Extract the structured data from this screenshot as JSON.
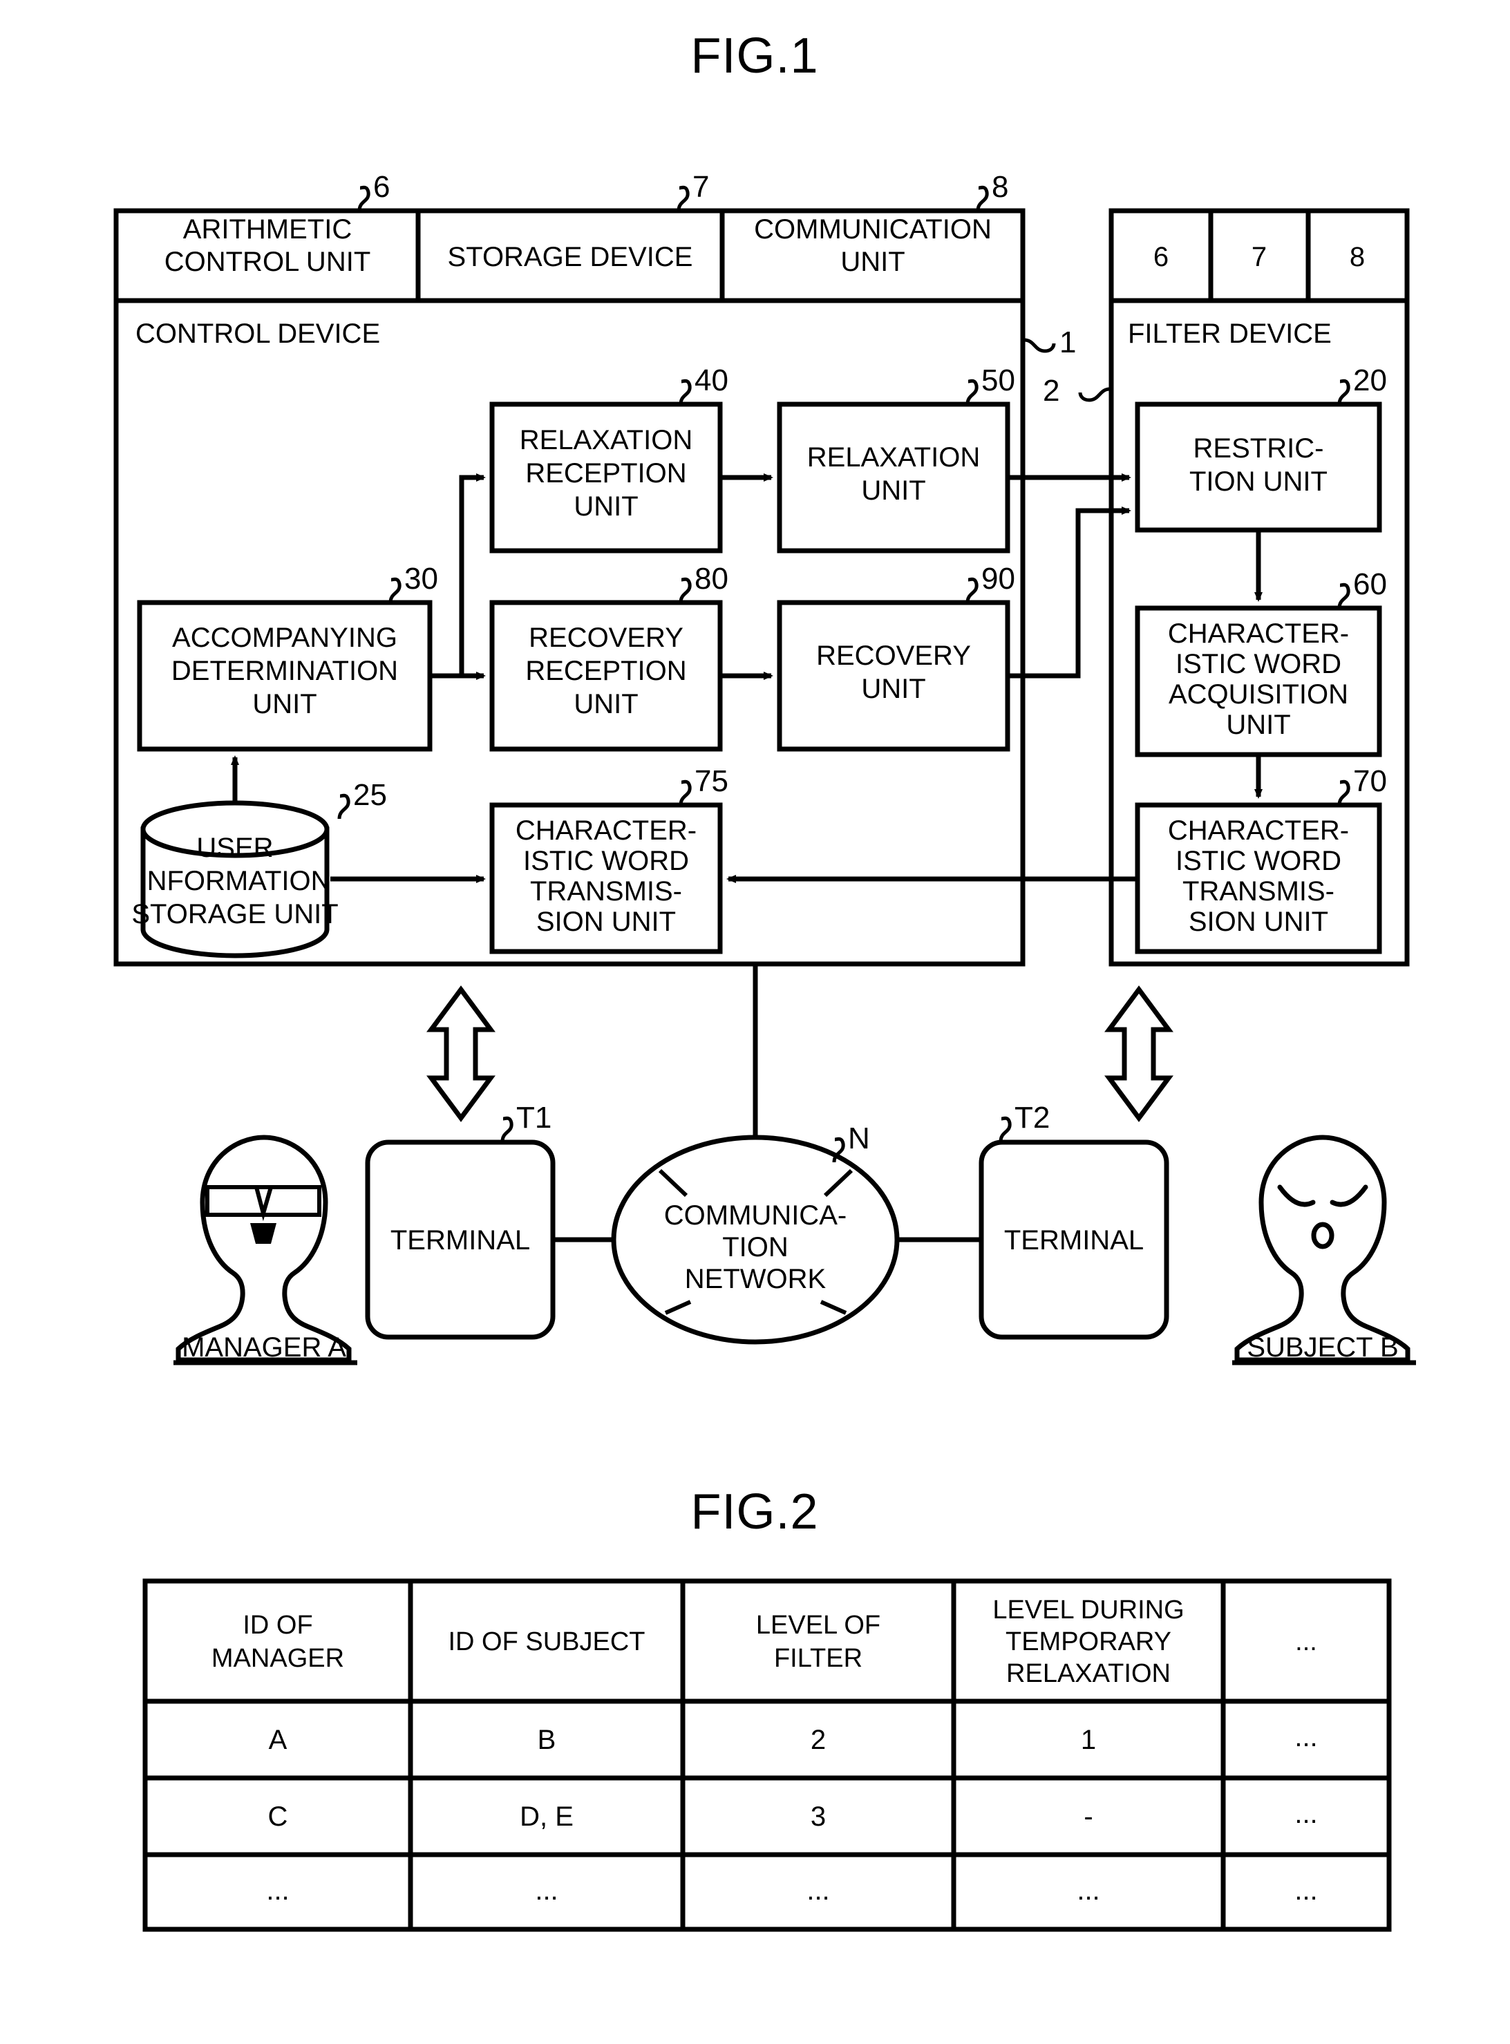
{
  "figures": [
    {
      "id": "fig1",
      "title": "FIG.1"
    },
    {
      "id": "fig2",
      "title": "FIG.2"
    }
  ],
  "fig1": {
    "title": "FIG.1",
    "control_device": {
      "name": "CONTROL DEVICE",
      "ref": "1",
      "hardware_row": [
        {
          "label": "ARITHMETIC CONTROL UNIT",
          "line1": "ARITHMETIC",
          "line2": "CONTROL UNIT",
          "ref": "6"
        },
        {
          "label": "STORAGE DEVICE",
          "line1": "STORAGE DEVICE",
          "line2": "",
          "ref": "7"
        },
        {
          "label": "COMMUNICATION UNIT",
          "line1": "COMMUNICATION",
          "line2": "UNIT",
          "ref": "8"
        }
      ],
      "blocks": [
        {
          "ref": "40",
          "lines": [
            "RELAXATION",
            "RECEPTION",
            "UNIT"
          ]
        },
        {
          "ref": "50",
          "lines": [
            "RELAXATION",
            "UNIT"
          ]
        },
        {
          "ref": "30",
          "lines": [
            "ACCOMPANYING",
            "DETERMINATION",
            "UNIT"
          ]
        },
        {
          "ref": "80",
          "lines": [
            "RECOVERY",
            "RECEPTION",
            "UNIT"
          ]
        },
        {
          "ref": "90",
          "lines": [
            "RECOVERY",
            "UNIT"
          ]
        },
        {
          "ref": "25",
          "lines": [
            "USER",
            "INFORMATION",
            "STORAGE UNIT"
          ],
          "shape": "cylinder"
        },
        {
          "ref": "75",
          "lines": [
            "CHARACTER-",
            "ISTIC WORD",
            "TRANSMIS-",
            "SION UNIT"
          ]
        }
      ]
    },
    "filter_device": {
      "name": "FILTER DEVICE",
      "ref": "2",
      "hardware_row": [
        {
          "label": "6"
        },
        {
          "label": "7"
        },
        {
          "label": "8"
        }
      ],
      "blocks": [
        {
          "ref": "20",
          "lines": [
            "RESTRIC-",
            "TION UNIT"
          ]
        },
        {
          "ref": "60",
          "lines": [
            "CHARACTER-",
            "ISTIC WORD",
            "ACQUISITION",
            "UNIT"
          ]
        },
        {
          "ref": "70",
          "lines": [
            "CHARACTER-",
            "ISTIC WORD",
            "TRANSMIS-",
            "SION UNIT"
          ]
        }
      ]
    },
    "bottom": {
      "manager": {
        "label": "MANAGER A"
      },
      "subject": {
        "label": "SUBJECT B"
      },
      "terminal_left": {
        "label": "TERMINAL",
        "ref": "T1"
      },
      "terminal_right": {
        "label": "TERMINAL",
        "ref": "T2"
      },
      "network": {
        "lines": [
          "COMMUNICA-",
          "TION",
          "NETWORK"
        ],
        "ref": "N"
      }
    }
  },
  "fig2": {
    "title": "FIG.2",
    "table": {
      "headers": [
        {
          "lines": [
            "ID OF",
            "MANAGER"
          ]
        },
        {
          "lines": [
            "ID OF SUBJECT"
          ]
        },
        {
          "lines": [
            "LEVEL OF",
            "FILTER"
          ]
        },
        {
          "lines": [
            "LEVEL DURING",
            "TEMPORARY",
            "RELAXATION"
          ]
        },
        {
          "lines": [
            "..."
          ]
        }
      ],
      "rows": [
        [
          "A",
          "B",
          "2",
          "1",
          "..."
        ],
        [
          "C",
          "D, E",
          "3",
          "-",
          "..."
        ],
        [
          "...",
          "...",
          "...",
          "...",
          "..."
        ]
      ]
    }
  }
}
